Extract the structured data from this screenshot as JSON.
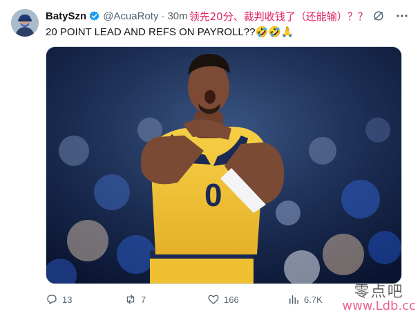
{
  "tweet": {
    "author_name": "BatySzn",
    "handle": "@AcuaRoty",
    "separator": "·",
    "time": "30m",
    "overlay_comment": "领先20分、裁判收钱了（还能输）？？",
    "text": "20 POINT LEAD AND REFS ON PAYROLL??🤣🤣🙏"
  },
  "actions": {
    "replies": "13",
    "reposts": "7",
    "likes": "166",
    "views": "6.7K"
  },
  "watermark": {
    "chinese": "零点吧",
    "url": "www.Ldb.cc"
  },
  "colors": {
    "verified": "#1d9bf0",
    "overlay_text": "#e0245e",
    "jersey": "#f2c12e",
    "jersey_trim": "#1b2a55"
  }
}
